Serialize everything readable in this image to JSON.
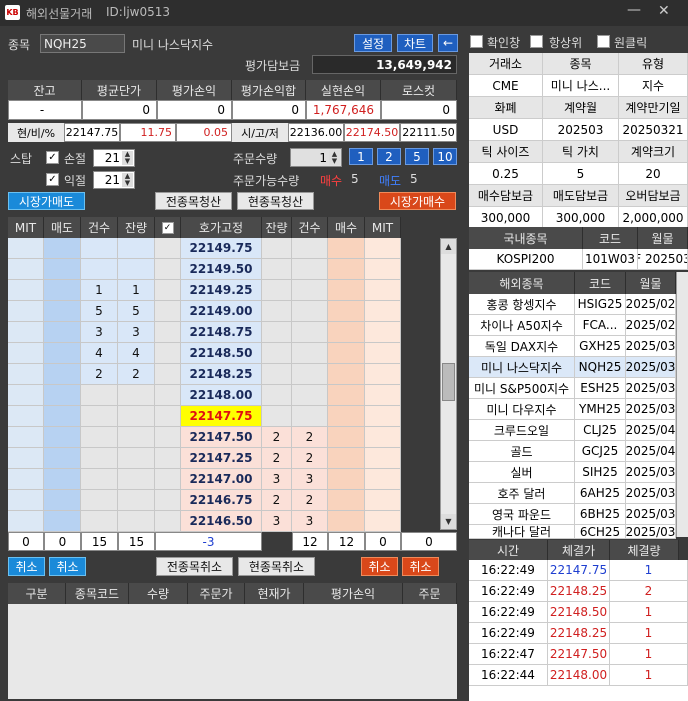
{
  "window": {
    "title": "해외선물거래",
    "user_label": "ID:",
    "user_id": "ljw0513",
    "logo": "KB",
    "icon": "broker-logo"
  },
  "product": {
    "label": "종목",
    "code": "NQH25",
    "name": "미니 나스닥지수"
  },
  "toolbar": {
    "settings": "설정",
    "chart": "차트",
    "back": "←"
  },
  "options": {
    "confirm": "확인창",
    "topmost": "항상위",
    "oneclick": "원클릭"
  },
  "margin": {
    "label": "평가담보금",
    "value": "13,649,942"
  },
  "summary": {
    "headers": [
      "잔고",
      "평균단가",
      "평가손익",
      "평가손익합",
      "실현손익",
      "로스컷"
    ],
    "values": [
      "-",
      "0",
      "0",
      "0",
      "1,767,646",
      "0"
    ]
  },
  "price_row": {
    "label1": "현/비/%",
    "cur": "22147.75",
    "chg": "11.75",
    "pct": "0.05",
    "label2": "시/고/저",
    "open": "22136.00",
    "high": "22174.50",
    "low": "22111.50"
  },
  "stop": {
    "label": "스탑",
    "loss_label": "손절",
    "loss_val": "21",
    "profit_label": "익절",
    "profit_val": "21"
  },
  "order": {
    "qty_label": "주문수량",
    "qty_val": "1",
    "quick": [
      "1",
      "2",
      "5",
      "10"
    ],
    "avail_label": "주문가능수량",
    "sell_label": "매수",
    "sell_val": "5",
    "buy_label": "매도",
    "buy_val": "5"
  },
  "actions": {
    "market_sell": "시장가매도",
    "close_all": "전종목청산",
    "close_cur": "현종목청산",
    "market_buy": "시장가매수"
  },
  "ladder": {
    "headers": [
      "MIT",
      "매도",
      "건수",
      "잔량",
      "",
      "호가고정",
      "잔량",
      "건수",
      "매수",
      "MIT"
    ],
    "rows": [
      {
        "price": "22149.75",
        "sc": "",
        "sq": "",
        "bq": "",
        "bc": "",
        "side": "sell"
      },
      {
        "price": "22149.50",
        "sc": "",
        "sq": "",
        "bq": "",
        "bc": "",
        "side": "sell"
      },
      {
        "price": "22149.25",
        "sc": "1",
        "sq": "1",
        "bq": "",
        "bc": "",
        "side": "sell"
      },
      {
        "price": "22149.00",
        "sc": "5",
        "sq": "5",
        "bq": "",
        "bc": "",
        "side": "sell"
      },
      {
        "price": "22148.75",
        "sc": "3",
        "sq": "3",
        "bq": "",
        "bc": "",
        "side": "sell"
      },
      {
        "price": "22148.50",
        "sc": "4",
        "sq": "4",
        "bq": "",
        "bc": "",
        "side": "sell"
      },
      {
        "price": "22148.25",
        "sc": "2",
        "sq": "2",
        "bq": "",
        "bc": "",
        "side": "sell"
      },
      {
        "price": "22148.00",
        "sc": "",
        "sq": "",
        "bq": "",
        "bc": "",
        "side": "mid"
      },
      {
        "price": "22147.75",
        "sc": "",
        "sq": "",
        "bq": "",
        "bc": "",
        "side": "cur"
      },
      {
        "price": "22147.50",
        "sc": "",
        "sq": "",
        "bq": "2",
        "bc": "2",
        "side": "buy"
      },
      {
        "price": "22147.25",
        "sc": "",
        "sq": "",
        "bq": "2",
        "bc": "2",
        "side": "buy"
      },
      {
        "price": "22147.00",
        "sc": "",
        "sq": "",
        "bq": "3",
        "bc": "3",
        "side": "buy"
      },
      {
        "price": "22146.75",
        "sc": "",
        "sq": "",
        "bq": "2",
        "bc": "2",
        "side": "buy"
      },
      {
        "price": "22146.50",
        "sc": "",
        "sq": "",
        "bq": "3",
        "bc": "3",
        "side": "buy"
      }
    ],
    "totals": [
      "0",
      "0",
      "15",
      "15",
      "-3",
      "12",
      "12",
      "0",
      "0"
    ]
  },
  "cancel": {
    "cancel": "취소",
    "cancel_all": "전종목취소",
    "cancel_cur": "현종목취소"
  },
  "positions": {
    "headers": [
      "구분",
      "종목코드",
      "수량",
      "주문가",
      "현재가",
      "평가손익",
      "주문"
    ]
  },
  "spec": {
    "rows": [
      [
        "거래소",
        "종목",
        "유형"
      ],
      [
        "CME",
        "미니 나스...",
        "지수"
      ],
      [
        "화폐",
        "계약월",
        "계약만기일"
      ],
      [
        "USD",
        "202503",
        "20250321"
      ],
      [
        "틱 사이즈",
        "틱 가치",
        "계약크기"
      ],
      [
        "0.25",
        "5",
        "20"
      ],
      [
        "매수담보금",
        "매도담보금",
        "오버담보금"
      ],
      [
        "300,000",
        "300,000",
        "2,000,000"
      ]
    ]
  },
  "domestic": {
    "headers": [
      "국내종목",
      "코드",
      "월물"
    ],
    "row": [
      "KOSPI200",
      "101W03",
      "F 202503"
    ]
  },
  "overseas": {
    "headers": [
      "해외종목",
      "코드",
      "월물"
    ],
    "rows": [
      [
        "홍콩 항셍지수",
        "HSIG25",
        "2025/02"
      ],
      [
        "차이나 A50지수",
        "FCA...",
        "2025/02"
      ],
      [
        "독일 DAX지수",
        "GXH25",
        "2025/03"
      ],
      [
        "미니 나스닥지수",
        "NQH25",
        "2025/03"
      ],
      [
        "미니 S&P500지수",
        "ESH25",
        "2025/03"
      ],
      [
        "미니 다우지수",
        "YMH25",
        "2025/03"
      ],
      [
        "크루드오일",
        "CLJ25",
        "2025/04"
      ],
      [
        "골드",
        "GCJ25",
        "2025/04"
      ],
      [
        "실버",
        "SIH25",
        "2025/03"
      ],
      [
        "호주 달러",
        "6AH25",
        "2025/03"
      ],
      [
        "영국 파운드",
        "6BH25",
        "2025/03"
      ],
      [
        "캐나다 달러",
        "6CH25",
        "2025/03"
      ]
    ]
  },
  "trades": {
    "headers": [
      "시간",
      "체결가",
      "체결량"
    ],
    "rows": [
      {
        "t": "16:22:49",
        "p": "22147.75",
        "q": "1",
        "c": "#1f3fd0"
      },
      {
        "t": "16:22:49",
        "p": "22148.25",
        "q": "2",
        "c": "#d01f1f"
      },
      {
        "t": "16:22:49",
        "p": "22148.50",
        "q": "1",
        "c": "#d01f1f"
      },
      {
        "t": "16:22:49",
        "p": "22148.25",
        "q": "1",
        "c": "#d01f1f"
      },
      {
        "t": "16:22:47",
        "p": "22147.50",
        "q": "1",
        "c": "#d01f1f"
      },
      {
        "t": "16:22:44",
        "p": "22148.00",
        "q": "1",
        "c": "#d01f1f"
      }
    ]
  }
}
